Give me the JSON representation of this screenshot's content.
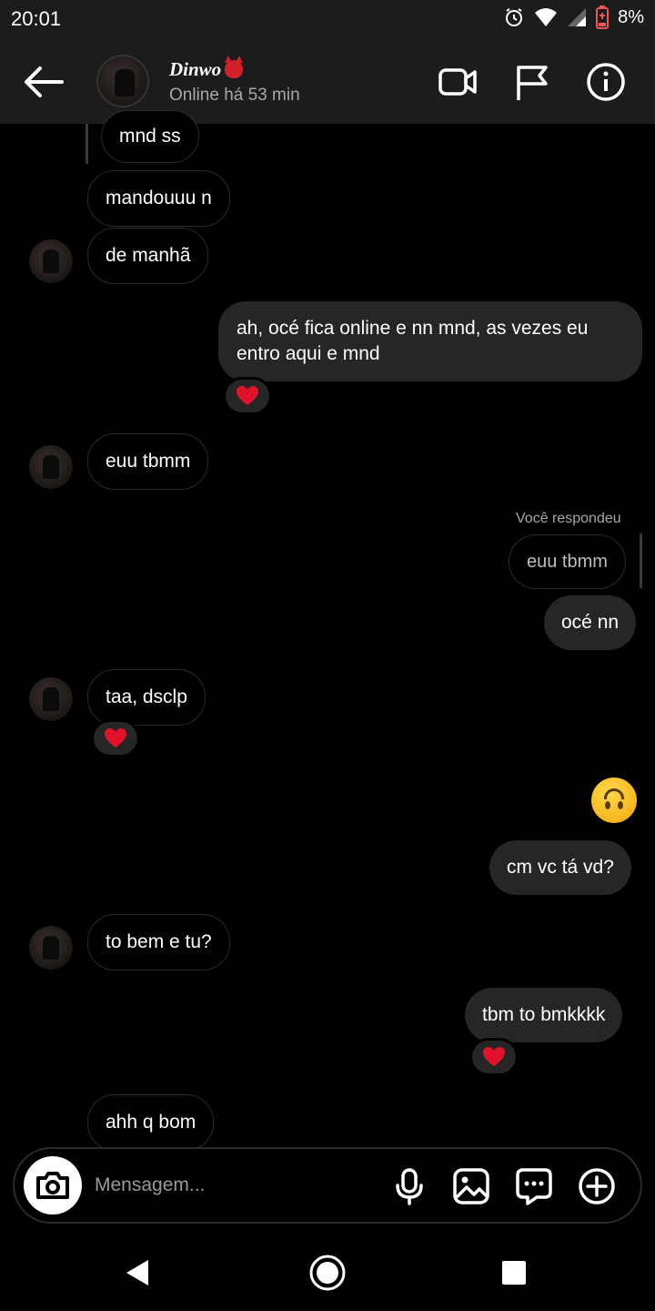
{
  "status_bar": {
    "time": "20:01",
    "battery": "8%"
  },
  "header": {
    "name": "Dinwo",
    "status": "Online há 53 min"
  },
  "messages": {
    "m1": "mnd ss",
    "m2": "mandouuu n",
    "m3": "de manhã",
    "m4_line1": "ah, océ fica online e nn mnd, as vezes eu",
    "m4_line2": "entro aqui e mnd",
    "m5": "euu tbmm",
    "reply_label": "Você respondeu",
    "reply_quote": "euu tbmm",
    "m6": "océ nn",
    "m7": "taa, dsclp",
    "m9": "cm vc tá vd?",
    "m10": "to bem e tu?",
    "m11": "tbm to bmkkkk",
    "m12": "ahh q bom"
  },
  "composer": {
    "placeholder": "Mensagem..."
  },
  "colors": {
    "reaction_heart": "#e0132b",
    "bubble_out": "#262626",
    "bubble_in_border": "#2b2b2b"
  }
}
